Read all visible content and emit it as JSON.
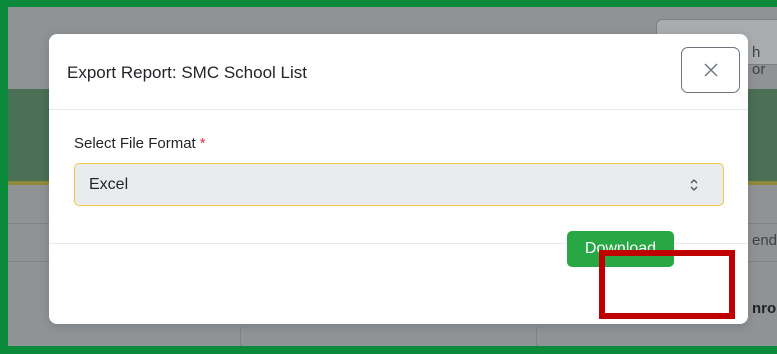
{
  "background": {
    "search_fragment": "h or",
    "row_fragment": "end",
    "column_fragment": "nroll"
  },
  "modal": {
    "title": "Export Report: SMC School List",
    "close_icon": "close-icon",
    "field_label": "Select File Format",
    "required_mark": "*",
    "selected_format": "Excel",
    "download_label": "Download"
  },
  "colors": {
    "frame": "#0a8a3a",
    "download_button": "#28a745",
    "highlight": "#c00000",
    "required": "#dc3545"
  }
}
